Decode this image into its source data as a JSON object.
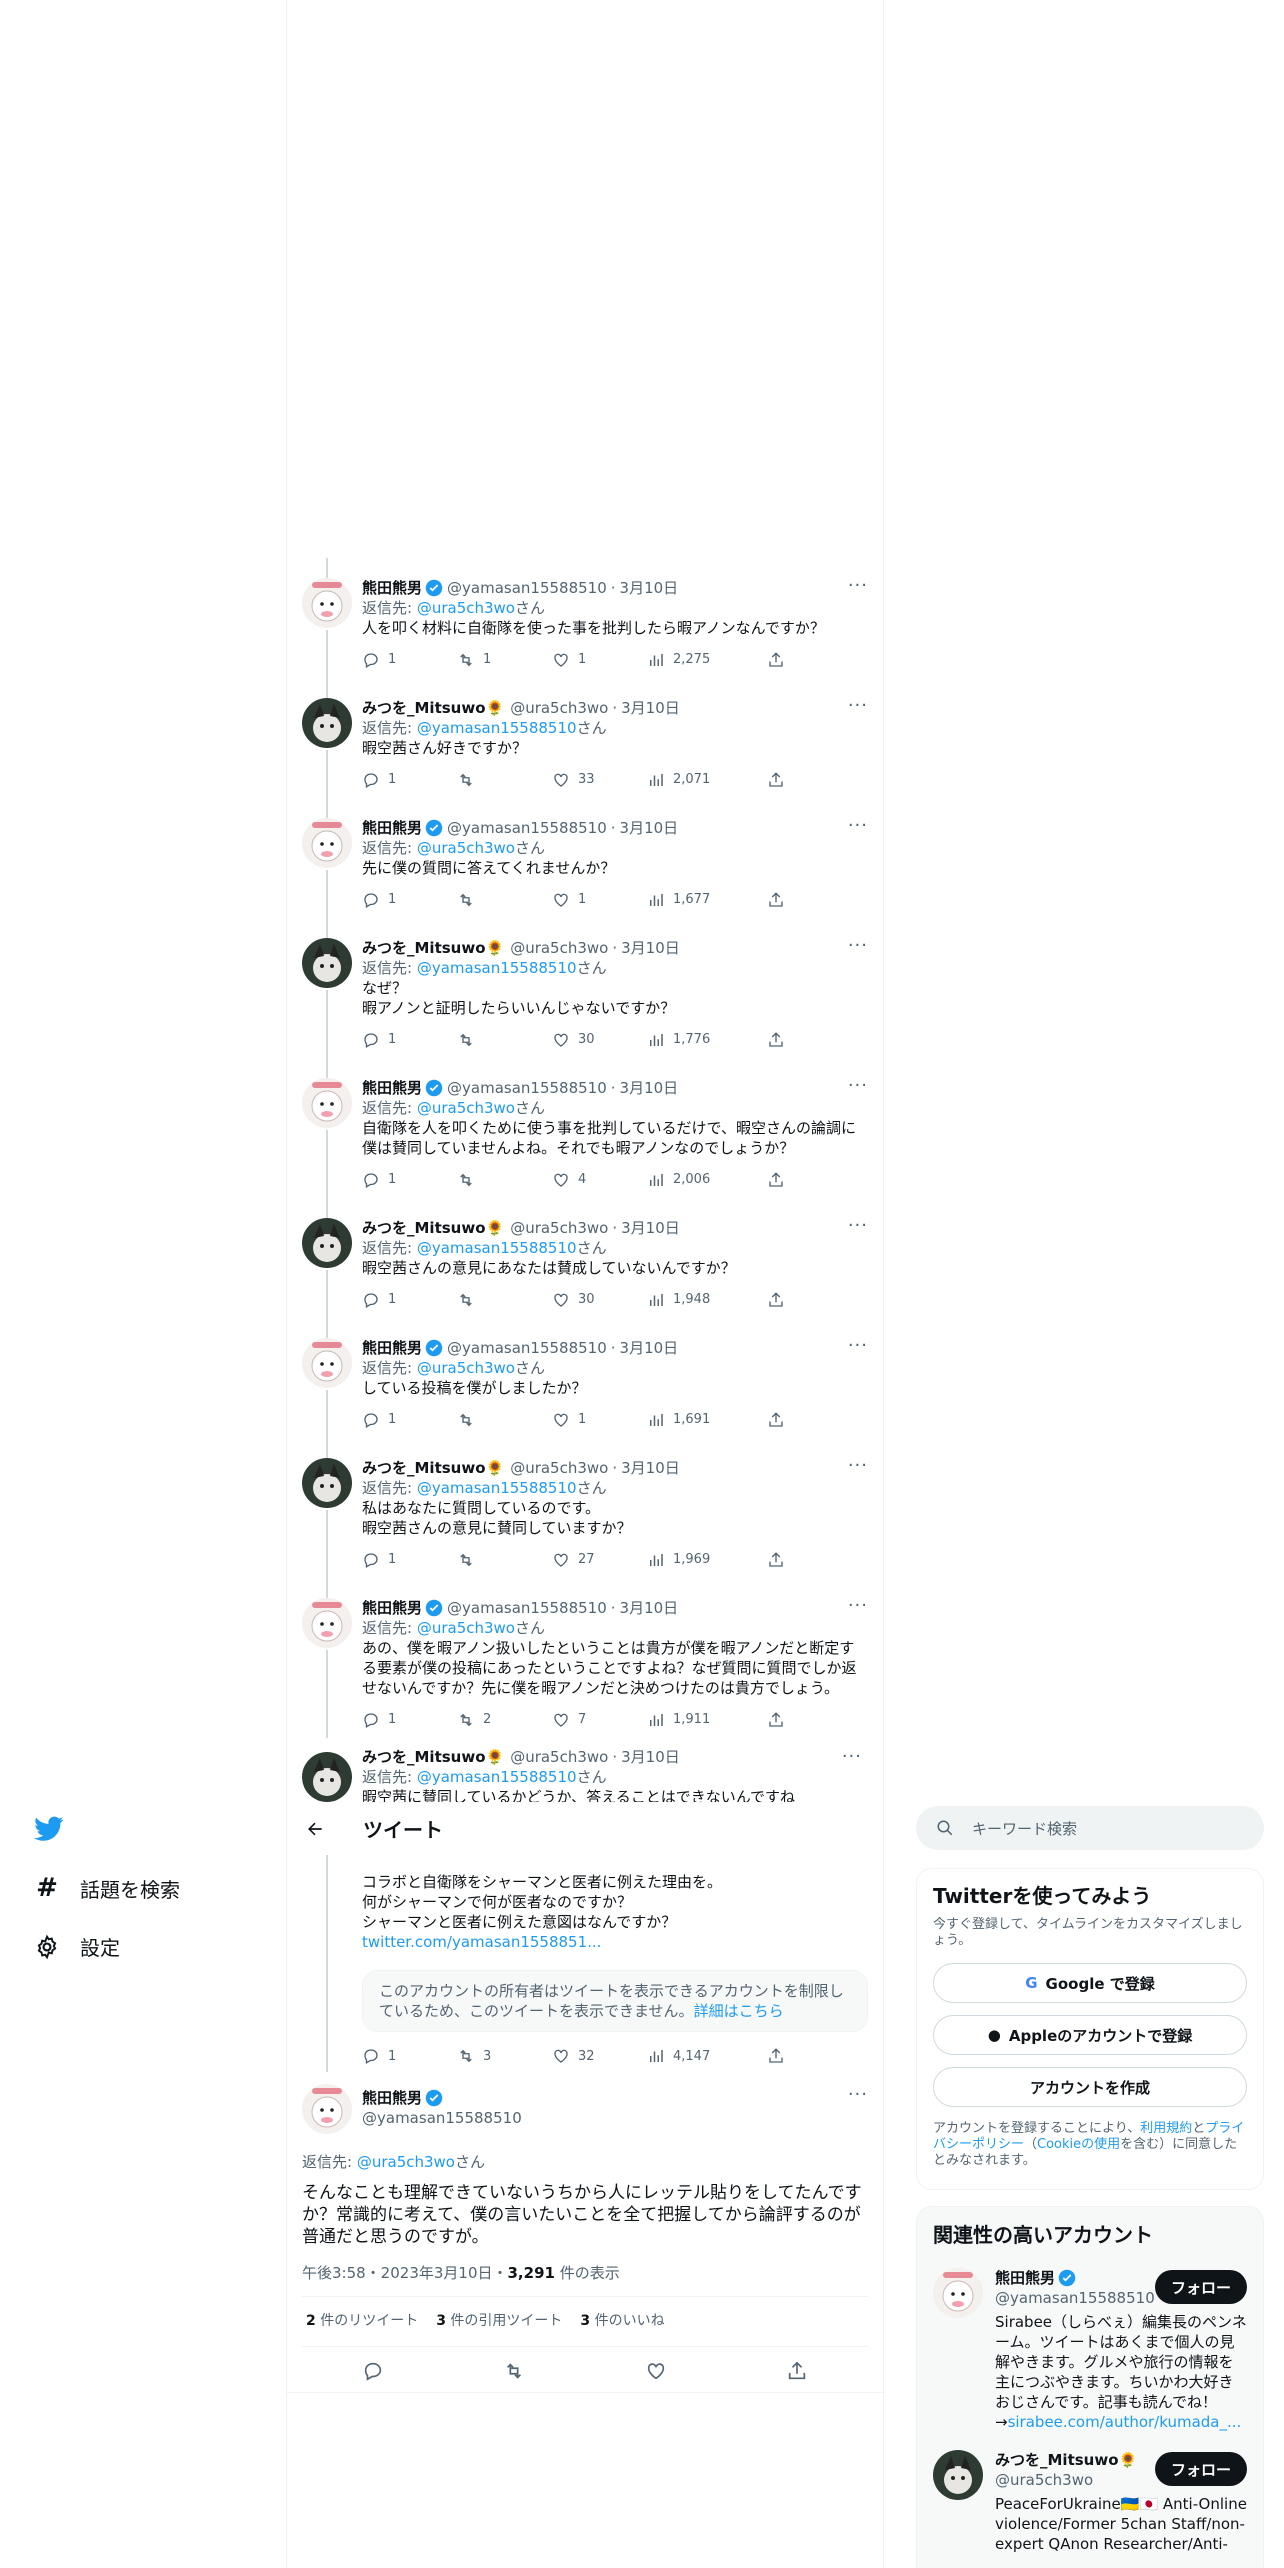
{
  "nav": {
    "explore_label": "話題を検索",
    "settings_label": "設定"
  },
  "header": {
    "title": "ツイート"
  },
  "thread": [
    {
      "author": "yamasan",
      "name": "熊田熊男",
      "handle": "@yamasan15588510",
      "date": "3月10日",
      "reply_prefix": "返信先: ",
      "reply_to": "@ura5ch3wo",
      "reply_suffix": "さん",
      "text": "人を叩く材料に自衛隊を使った事を批判したら暇アノンなんですか？",
      "replies": "1",
      "retweets": "1",
      "likes": "1",
      "views": "2,275"
    },
    {
      "author": "mitsuwo",
      "name": "みつを_Mitsuwo🌻",
      "handle": "@ura5ch3wo",
      "date": "3月10日",
      "reply_prefix": "返信先: ",
      "reply_to": "@yamasan15588510",
      "reply_suffix": "さん",
      "text": "暇空茜さん好きですか？",
      "replies": "1",
      "retweets": "",
      "likes": "33",
      "views": "2,071"
    },
    {
      "author": "yamasan",
      "name": "熊田熊男",
      "handle": "@yamasan15588510",
      "date": "3月10日",
      "reply_prefix": "返信先: ",
      "reply_to": "@ura5ch3wo",
      "reply_suffix": "さん",
      "text": "先に僕の質問に答えてくれませんか？",
      "replies": "1",
      "retweets": "",
      "likes": "1",
      "views": "1,677"
    },
    {
      "author": "mitsuwo",
      "name": "みつを_Mitsuwo🌻",
      "handle": "@ura5ch3wo",
      "date": "3月10日",
      "reply_prefix": "返信先: ",
      "reply_to": "@yamasan15588510",
      "reply_suffix": "さん",
      "text": "なぜ？\n暇アノンと証明したらいいんじゃないですか？",
      "replies": "1",
      "retweets": "",
      "likes": "30",
      "views": "1,776"
    },
    {
      "author": "yamasan",
      "name": "熊田熊男",
      "handle": "@yamasan15588510",
      "date": "3月10日",
      "reply_prefix": "返信先: ",
      "reply_to": "@ura5ch3wo",
      "reply_suffix": "さん",
      "text": "自衛隊を人を叩くために使う事を批判しているだけで、暇空さんの論調に僕は賛同していませんよね。それでも暇アノンなのでしょうか？",
      "replies": "1",
      "retweets": "",
      "likes": "4",
      "views": "2,006"
    },
    {
      "author": "mitsuwo",
      "name": "みつを_Mitsuwo🌻",
      "handle": "@ura5ch3wo",
      "date": "3月10日",
      "reply_prefix": "返信先: ",
      "reply_to": "@yamasan15588510",
      "reply_suffix": "さん",
      "text": "暇空茜さんの意見にあなたは賛成していないんですか？",
      "replies": "1",
      "retweets": "",
      "likes": "30",
      "views": "1,948"
    },
    {
      "author": "yamasan",
      "name": "熊田熊男",
      "handle": "@yamasan15588510",
      "date": "3月10日",
      "reply_prefix": "返信先: ",
      "reply_to": "@ura5ch3wo",
      "reply_suffix": "さん",
      "text": "している投稿を僕がしましたか？",
      "replies": "1",
      "retweets": "",
      "likes": "1",
      "views": "1,691"
    },
    {
      "author": "mitsuwo",
      "name": "みつを_Mitsuwo🌻",
      "handle": "@ura5ch3wo",
      "date": "3月10日",
      "reply_prefix": "返信先: ",
      "reply_to": "@yamasan15588510",
      "reply_suffix": "さん",
      "text": "私はあなたに質問しているのです。\n暇空茜さんの意見に賛同していますか？",
      "replies": "1",
      "retweets": "",
      "likes": "27",
      "views": "1,969"
    },
    {
      "author": "yamasan",
      "name": "熊田熊男",
      "handle": "@yamasan15588510",
      "date": "3月10日",
      "reply_prefix": "返信先: ",
      "reply_to": "@ura5ch3wo",
      "reply_suffix": "さん",
      "text": "あの、僕を暇アノン扱いしたということは貴方が僕を暇アノンだと断定する要素が僕の投稿にあったということですよね？なぜ質問に質問でしか返せないんですか？先に僕を暇アノンだと決めつけたのは貴方でしょう。",
      "replies": "1",
      "retweets": "2",
      "likes": "7",
      "views": "1,911"
    }
  ],
  "partial_tweet": {
    "name": "みつを_Mitsuwo🌻",
    "handle": "@ura5ch3wo",
    "date": "3月10日",
    "reply_prefix": "返信先: ",
    "reply_to": "@yamasan15588510",
    "reply_suffix": "さん",
    "text_cut": "暇空茜に賛同しているかどうか、答えることはできないんですね"
  },
  "quoted_tweet": {
    "text": "コラボと自衛隊をシャーマンと医者に例えた理由を。\n何がシャーマンで何が医者なのですか？\nシャーマンと医者に例えた意図はなんですか？",
    "link": "twitter.com/yamasan1558851...",
    "notice": "このアカウントの所有者はツイートを表示できるアカウントを制限しているため、このツイートを表示できません。",
    "notice_link": "詳細はこちら",
    "replies": "1",
    "retweets": "3",
    "likes": "32",
    "views": "4,147"
  },
  "main_tweet": {
    "name": "熊田熊男",
    "handle": "@yamasan15588510",
    "reply_prefix": "返信先: ",
    "reply_to": "@ura5ch3wo",
    "reply_suffix": "さん",
    "text": "そんなことも理解できていないうちから人にレッテル貼りをしてたんですか？常識的に考えて、僕の言いたいことを全て把握してから論評するのが普通だと思うのですが。",
    "time": "午後3:58・2023年3月10日・",
    "views_count": "3,291",
    "views_label": " 件の表示",
    "stats": [
      {
        "count": "2",
        "label": " 件のリツイート"
      },
      {
        "count": "3",
        "label": " 件の引用ツイート"
      },
      {
        "count": "3",
        "label": " 件のいいね"
      }
    ]
  },
  "search": {
    "placeholder": "キーワード検索"
  },
  "signup": {
    "title": "Twitterを使ってみよう",
    "subtitle": "今すぐ登録して、タイムラインをカスタマイズしましょう。",
    "google": "Google で登録",
    "apple": "Appleのアカウントで登録",
    "create": "アカウントを作成",
    "legal_1": "アカウントを登録することにより、",
    "legal_terms": "利用規約",
    "legal_2": "と",
    "legal_privacy": "プライバシーポリシー",
    "legal_3": "（",
    "legal_cookie": "Cookieの使用",
    "legal_4": "を含む）に同意したとみなされます。"
  },
  "related": {
    "title": "関連性の高いアカウント",
    "follow_label": "フォロー",
    "accounts": [
      {
        "name": "熊田熊男",
        "handle": "@yamasan15588510",
        "bio": "Sirabee（しらべぇ）編集長のペンネーム。ツイートはあくまで個人の見解やきます。グルメや旅行の情報を主につぶやきます。ちいかわ大好きおじさんです。記事も読んでね！\n→",
        "bio_link": "sirabee.com/author/kumada_..."
      },
      {
        "name": "みつを_Mitsuwo🌻",
        "handle": "@ura5ch3wo",
        "bio": "PeaceForUkraine🇺🇦🇯🇵 Anti-Online violence/Former 5chan Staff/non-expert QAnon Researcher/Anti-"
      }
    ]
  },
  "colors": {
    "accent": "#1d9bf0",
    "text": "#0f1419",
    "muted": "#536471",
    "border": "#eff3f4"
  }
}
